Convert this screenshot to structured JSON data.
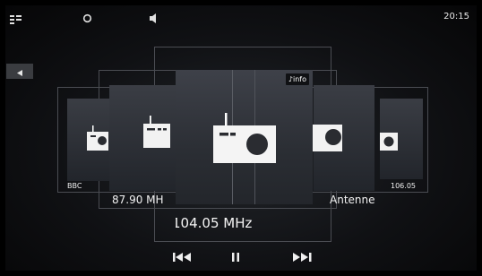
{
  "status_bar": {
    "time": "20:15",
    "icons": [
      "menu-grid-icon",
      "circle-icon",
      "speaker-icon"
    ]
  },
  "navigation": {
    "back_icon": "triangle-left-icon"
  },
  "stations": [
    {
      "label": "BBC"
    },
    {
      "label": "87.90 MH"
    },
    {
      "label": "104.05 MHz",
      "info_label": "info"
    },
    {
      "label": "Antenne"
    },
    {
      "label": "106.05"
    }
  ],
  "controls": {
    "previous_icon": "skip-previous-icon",
    "pause_icon": "pause-icon",
    "next_icon": "skip-next-icon"
  },
  "colors": {
    "background": "#000000",
    "card_art": "#33363c",
    "frame_border": "#4a4c52",
    "text": "#ffffff"
  }
}
